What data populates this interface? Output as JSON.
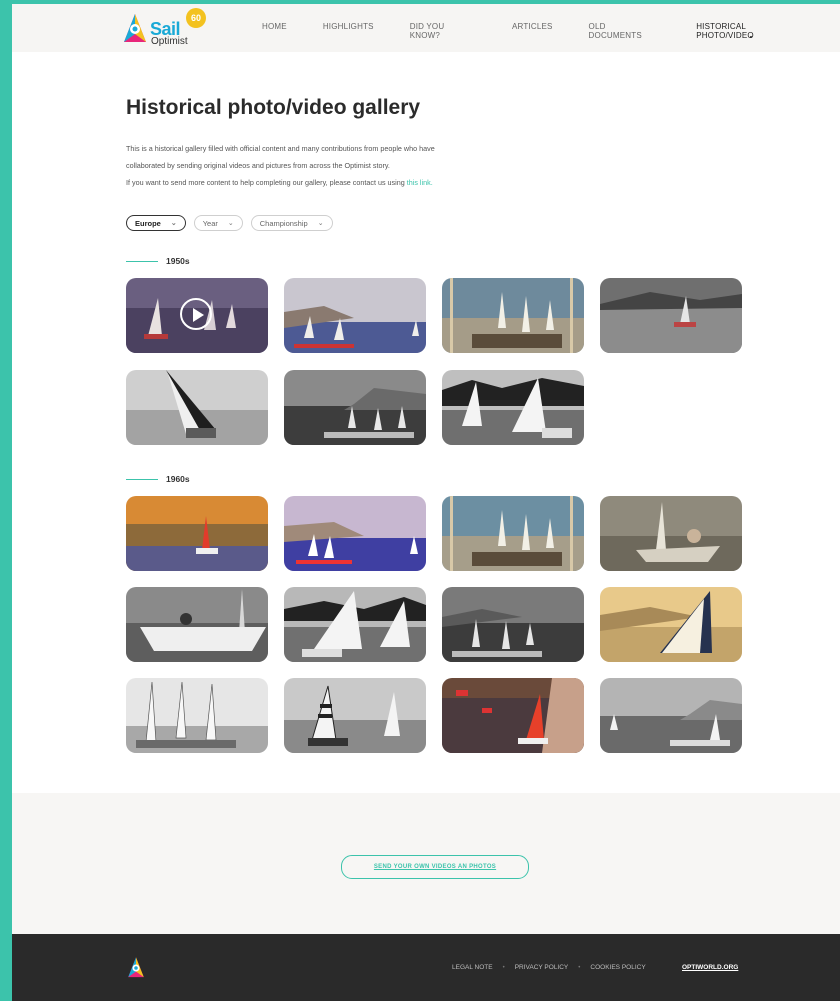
{
  "brand": {
    "name": "Sail",
    "sub": "Optimist",
    "badge": "60",
    "accent": "#3cc3ab"
  },
  "nav": {
    "items": [
      {
        "label": "HOME"
      },
      {
        "label": "HIGHLIGHTS"
      },
      {
        "label": "DID YOU KNOW?"
      },
      {
        "label": "ARTICLES"
      },
      {
        "label": "OLD DOCUMENTS"
      },
      {
        "label": "HISTORICAL PHOTO/VIDEO"
      }
    ],
    "active": "HISTORICAL PHOTO/VIDEO"
  },
  "page": {
    "title": "Historical photo/video gallery",
    "intro_1": "This is a historical gallery filled with official content and many contributions from people who have",
    "intro_2": "collaborated by sending original videos and pictures from across the Optimist story.",
    "intro_3": "If you want to send more content to help completing our gallery, please contact us using ",
    "intro_link": "this link."
  },
  "filters": {
    "region": "Europe",
    "year": "Year",
    "championship": "Championship"
  },
  "gallery": {
    "decade_1": "1950s",
    "decade_2": "1960s"
  },
  "cta": {
    "label": "SEND YOUR OWN VIDEOS AN PHOTOS"
  },
  "footer": {
    "legal": "LEGAL NOTE",
    "privacy": "PRIVACY POLICY",
    "cookies": "COOKIES POLICY",
    "site": "OPTIWORLD.ORG"
  }
}
